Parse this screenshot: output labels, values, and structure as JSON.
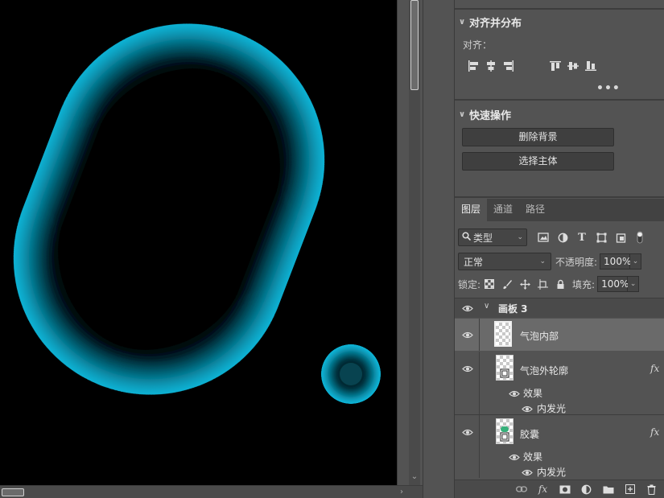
{
  "canvas": {
    "background": "#000000",
    "glow_color": "#19c8ee"
  },
  "align_panel": {
    "title": "对齐并分布",
    "align_label": "对齐：",
    "icons": [
      "align-left-edges-icon",
      "align-horizontal-centers-icon",
      "align-right-edges-icon",
      "align-top-edges-icon",
      "align-vertical-centers-icon",
      "align-bottom-edges-icon"
    ],
    "more": "•••"
  },
  "quick_actions": {
    "title": "快速操作",
    "buttons": [
      "删除背景",
      "选择主体"
    ]
  },
  "layers_panel": {
    "tabs": [
      "图层",
      "通道",
      "路径"
    ],
    "active_tab": 0,
    "filter_kind": "类型",
    "blend_mode": "正常",
    "opacity_label": "不透明度:",
    "opacity_value": "100%",
    "lock_label": "锁定:",
    "fill_label": "填充:",
    "fill_value": "100%",
    "group_name": "画板 3",
    "layers": [
      {
        "name": "气泡内部",
        "selected": true,
        "has_fx": false
      },
      {
        "name": "气泡外轮廓",
        "selected": false,
        "has_fx": true,
        "effects_label": "效果",
        "effect": "内发光"
      },
      {
        "name": "胶囊",
        "selected": false,
        "has_fx": true,
        "effects_label": "效果",
        "effect": "内发光"
      }
    ],
    "fx_symbol": "fx"
  }
}
